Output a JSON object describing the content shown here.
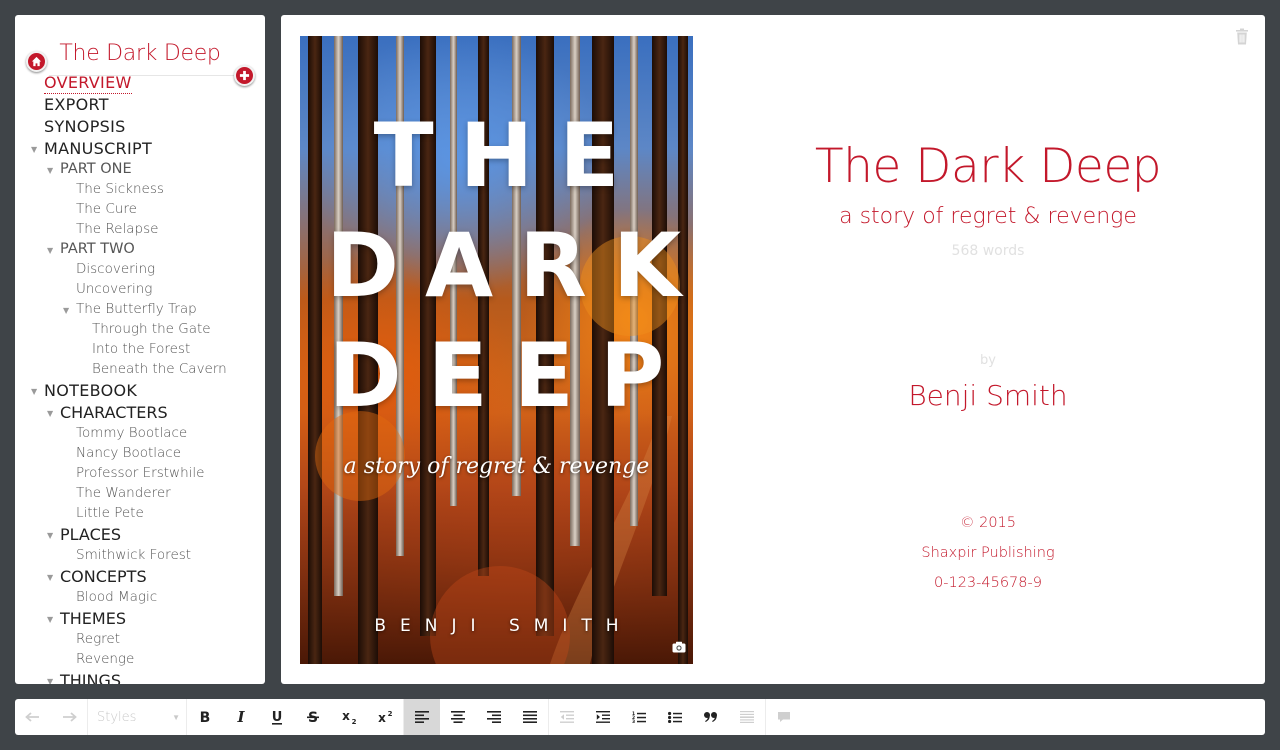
{
  "sidebar": {
    "title": "The Dark Deep",
    "tree": [
      {
        "label": "OVERVIEW",
        "level": 0,
        "active": true
      },
      {
        "label": "EXPORT",
        "level": 0
      },
      {
        "label": "SYNOPSIS",
        "level": 0
      },
      {
        "label": "MANUSCRIPT",
        "level": 0,
        "expanded": true
      },
      {
        "label": "PART ONE",
        "level": 1,
        "expanded": true
      },
      {
        "label": "The Sickness",
        "level": 2
      },
      {
        "label": "The Cure",
        "level": 2
      },
      {
        "label": "The Relapse",
        "level": 2
      },
      {
        "label": "PART TWO",
        "level": 1,
        "expanded": true
      },
      {
        "label": "Discovering",
        "level": 2
      },
      {
        "label": "Uncovering",
        "level": 2
      },
      {
        "label": "The Butterfly Trap",
        "level": 2,
        "expanded": true
      },
      {
        "label": "Through the Gate",
        "level": 3
      },
      {
        "label": "Into the Forest",
        "level": 3
      },
      {
        "label": "Beneath the Cavern",
        "level": 3
      },
      {
        "label": "NOTEBOOK",
        "level": 0,
        "expanded": true
      },
      {
        "label": "CHARACTERS",
        "level": 1,
        "expanded": true,
        "dark": true
      },
      {
        "label": "Tommy Bootlace",
        "level": 2
      },
      {
        "label": "Nancy Bootlace",
        "level": 2
      },
      {
        "label": "Professor Erstwhile",
        "level": 2
      },
      {
        "label": "The Wanderer",
        "level": 2
      },
      {
        "label": "Little Pete",
        "level": 2
      },
      {
        "label": "PLACES",
        "level": 1,
        "expanded": true,
        "dark": true
      },
      {
        "label": "Smithwick Forest",
        "level": 2
      },
      {
        "label": "CONCEPTS",
        "level": 1,
        "expanded": true,
        "dark": true
      },
      {
        "label": "Blood Magic",
        "level": 2
      },
      {
        "label": "THEMES",
        "level": 1,
        "expanded": true,
        "dark": true
      },
      {
        "label": "Regret",
        "level": 2
      },
      {
        "label": "Revenge",
        "level": 2
      },
      {
        "label": "THINGS",
        "level": 1,
        "expanded": true,
        "dark": true
      }
    ]
  },
  "cover": {
    "line1": "THE",
    "line2": "DARK",
    "line3": "DEEP",
    "subtitle": "a story of regret & revenge",
    "author": "BENJI SMITH"
  },
  "overview": {
    "title": "The Dark Deep",
    "subtitle": "a story of regret & revenge",
    "word_count": "568 words",
    "by": "by",
    "author": "Benji Smith",
    "copyright": "© 2015",
    "publisher": "Shaxpir Publishing",
    "isbn": "0-123-45678-9"
  },
  "toolbar": {
    "styles_placeholder": "Styles"
  },
  "colors": {
    "accent": "#c3182b",
    "background": "#3f4448"
  }
}
